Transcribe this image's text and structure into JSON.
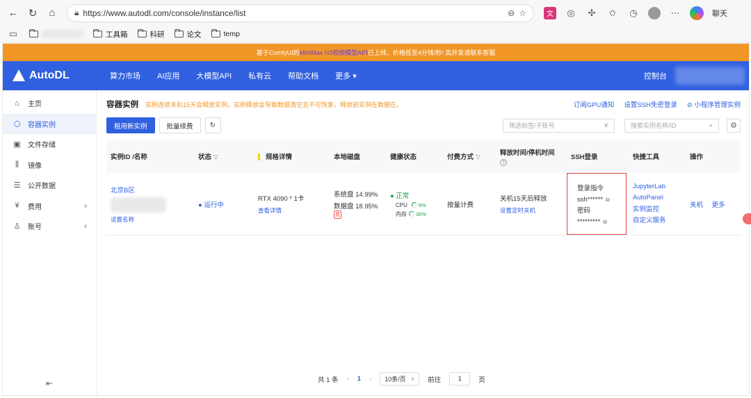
{
  "browser": {
    "url": "https://www.autodl.com/console/instance/list",
    "chat_label": "聊天"
  },
  "bookmarks": [
    {
      "label": "工具箱"
    },
    {
      "label": "科研"
    },
    {
      "label": "论文"
    },
    {
      "label": "temp"
    }
  ],
  "banner": {
    "prefix": "基于ComfyUI的",
    "highlight": "MiniMax H3视频模型API",
    "suffix": "已上线，价格低至4分钱/秒! 高并发请联系客服"
  },
  "topnav": {
    "logo": "AutoDL",
    "items": [
      "算力市场",
      "AI应用",
      "大模型API",
      "私有云",
      "帮助文档",
      "更多"
    ],
    "console": "控制台"
  },
  "sidebar": {
    "items": [
      {
        "label": "主页",
        "icon": "home-icon"
      },
      {
        "label": "容器实例",
        "icon": "container-icon"
      },
      {
        "label": "文件存储",
        "icon": "storage-icon"
      },
      {
        "label": "镜像",
        "icon": "image-icon"
      },
      {
        "label": "公开数据",
        "icon": "database-icon"
      },
      {
        "label": "费用",
        "icon": "yen-icon"
      },
      {
        "label": "账号",
        "icon": "user-icon"
      }
    ]
  },
  "main": {
    "title": "容器实例",
    "warning": "实例连续关机15天会释放实例，实例释放会导致数据清空且不可恢复，释放前实例在数据在。",
    "links": [
      "订阅GPU通知",
      "设置SSH免密登录",
      "小程序管理实例"
    ],
    "buttons": {
      "rent": "租用新实例",
      "batch_renew": "批量续费"
    },
    "filter_placeholder": "筛选标签/子账号",
    "search_placeholder": "搜索实例名称/ID"
  },
  "table": {
    "headers": [
      "实例ID /名称",
      "状态",
      "规格详情",
      "本地磁盘",
      "健康状态",
      "付费方式",
      "释放时间/停机时间",
      "SSH登录",
      "快捷工具",
      "操作"
    ],
    "row": {
      "region": "北京B区",
      "set_name": "设置名称",
      "status": "运行中",
      "spec": "RTX 4090 * 1卡",
      "spec_link": "查看详情",
      "disk_sys": "系统盘 14.99%",
      "disk_data": "数据盘 18.95%",
      "disk_badge": "费",
      "health": "正常",
      "cpu_label": "CPU",
      "cpu_pct": "6%",
      "mem_label": "内存",
      "mem_pct": "30%",
      "pay": "按量计费",
      "release": "关机15天后释放",
      "release_link": "设置定时关机",
      "ssh_cmd_label": "登录指令",
      "ssh_cmd": "ssh******",
      "pwd_label": "密码",
      "pwd": "*********",
      "tools": [
        "JupyterLab",
        "AutoPanel",
        "实例监控",
        "自定义服务"
      ],
      "actions": [
        "关机",
        "更多"
      ]
    }
  },
  "pager": {
    "total": "共 1 条",
    "current": "1",
    "page_size": "10条/页",
    "goto_label": "前往",
    "goto_value": "1",
    "page_unit": "页"
  }
}
